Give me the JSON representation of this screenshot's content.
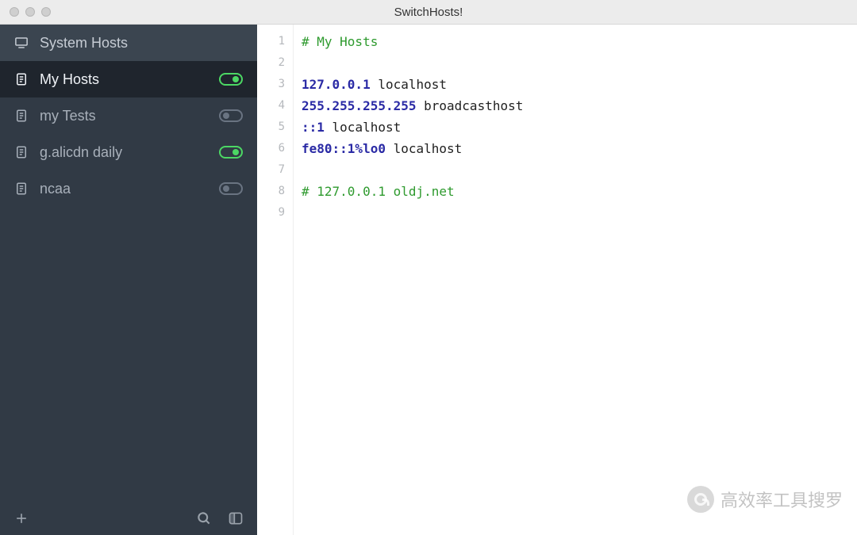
{
  "window": {
    "title": "SwitchHosts!"
  },
  "sidebar": {
    "items": [
      {
        "label": "System Hosts",
        "kind": "system",
        "toggle": null,
        "selected": false
      },
      {
        "label": "My Hosts",
        "kind": "file",
        "toggle": "on",
        "selected": true
      },
      {
        "label": "my Tests",
        "kind": "file",
        "toggle": "off",
        "selected": false
      },
      {
        "label": "g.alicdn daily",
        "kind": "file",
        "toggle": "on",
        "selected": false
      },
      {
        "label": "ncaa",
        "kind": "file",
        "toggle": "off",
        "selected": false
      }
    ]
  },
  "editor": {
    "line_count": 9,
    "lines": [
      [
        {
          "cls": "tok-comment",
          "text": "# My Hosts"
        }
      ],
      [],
      [
        {
          "cls": "tok-ip",
          "text": "127.0.0.1"
        },
        {
          "cls": "tok-host",
          "text": " localhost"
        }
      ],
      [
        {
          "cls": "tok-ip",
          "text": "255.255.255.255"
        },
        {
          "cls": "tok-host",
          "text": " broadcasthost"
        }
      ],
      [
        {
          "cls": "tok-ip",
          "text": "::1"
        },
        {
          "cls": "tok-host",
          "text": " localhost"
        }
      ],
      [
        {
          "cls": "tok-ip",
          "text": "fe80::1%lo0"
        },
        {
          "cls": "tok-host",
          "text": " localhost"
        }
      ],
      [],
      [
        {
          "cls": "tok-comment",
          "text": "# 127.0.0.1 oldj.net"
        }
      ],
      []
    ]
  },
  "watermark": {
    "text": "高效率工具搜罗"
  },
  "colors": {
    "accent_on": "#4cd864",
    "sidebar_bg": "#313a45",
    "selected_bg": "#1f252d"
  }
}
